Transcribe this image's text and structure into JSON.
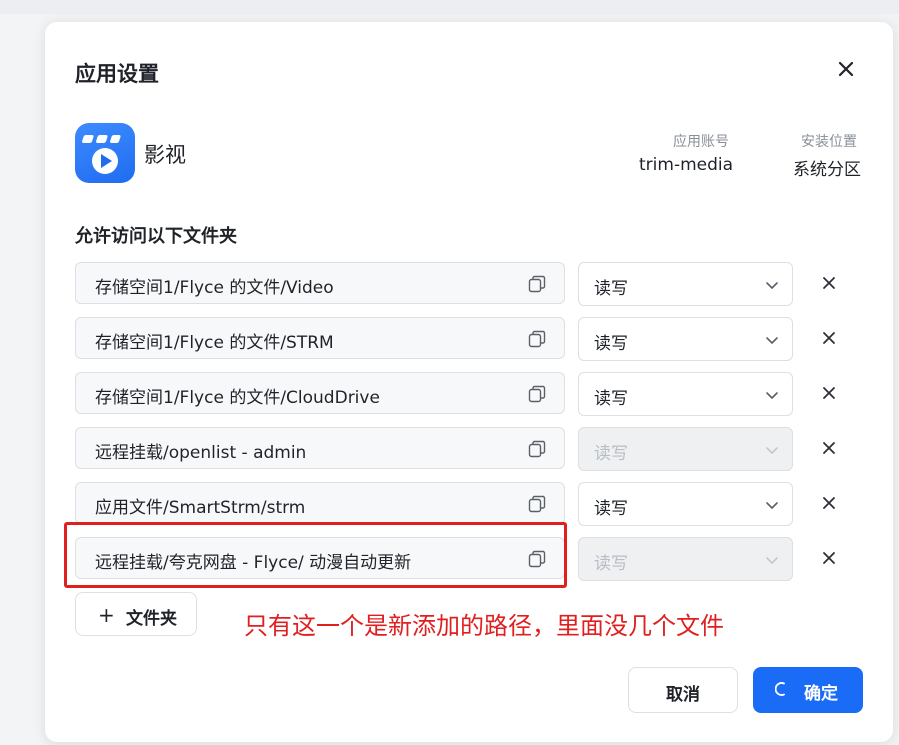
{
  "dialog": {
    "title": "应用设置",
    "app": {
      "name": "影视",
      "icon": "media-app-icon",
      "account_label": "应用账号",
      "account_value": "trim-media",
      "location_label": "安装位置",
      "location_value": "系统分区"
    },
    "section_title": "允许访问以下文件夹",
    "folders": [
      {
        "path": "存储空间1/Flyce 的文件/Video",
        "permission": "读写",
        "disabled": false
      },
      {
        "path": "存储空间1/Flyce 的文件/STRM",
        "permission": "读写",
        "disabled": false
      },
      {
        "path": "存储空间1/Flyce 的文件/CloudDrive",
        "permission": "读写",
        "disabled": false
      },
      {
        "path": "远程挂载/openlist - admin",
        "permission": "读写",
        "disabled": true
      },
      {
        "path": "应用文件/SmartStrm/strm",
        "permission": "读写",
        "disabled": false
      },
      {
        "path": "远程挂载/夸克网盘 - Flyce/ 动漫自动更新",
        "permission": "读写",
        "disabled": true
      }
    ],
    "add_folder_label": "文件夹",
    "annotation_text": "只有这一个是新添加的路径，里面没几个文件",
    "cancel_label": "取消",
    "confirm_label": "确定"
  },
  "colors": {
    "accent": "#1a6cf6",
    "annotation": "#e02020",
    "disabled_bg": "#eef0f2",
    "text_muted": "#8a8f99"
  }
}
